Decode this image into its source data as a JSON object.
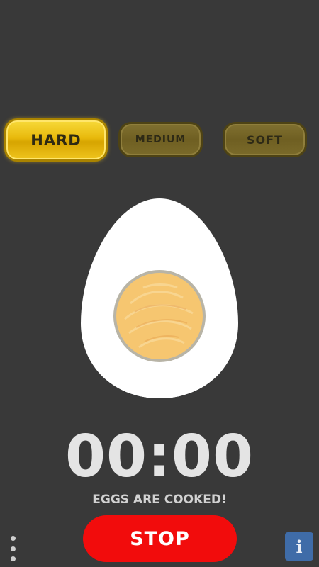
{
  "modes": {
    "hard": {
      "label": "HARD",
      "selected": true
    },
    "medium": {
      "label": "MEDIUM",
      "selected": false
    },
    "soft": {
      "label": "SOFT",
      "selected": false
    }
  },
  "egg": {
    "state": "hard-boiled-cross-section",
    "white_color": "#ffffff",
    "yolk_color": "#f6c670"
  },
  "timer": {
    "display": "00:00",
    "status": "EGGS ARE COOKED!"
  },
  "actions": {
    "stop_label": "STOP",
    "info_label": "i",
    "menu_icon": "vertical-dots-menu-icon"
  },
  "colors": {
    "background": "#393939",
    "accent_gold": "#e8b90c",
    "stop_red": "#f20c0c",
    "info_blue": "#3f6ca8"
  }
}
